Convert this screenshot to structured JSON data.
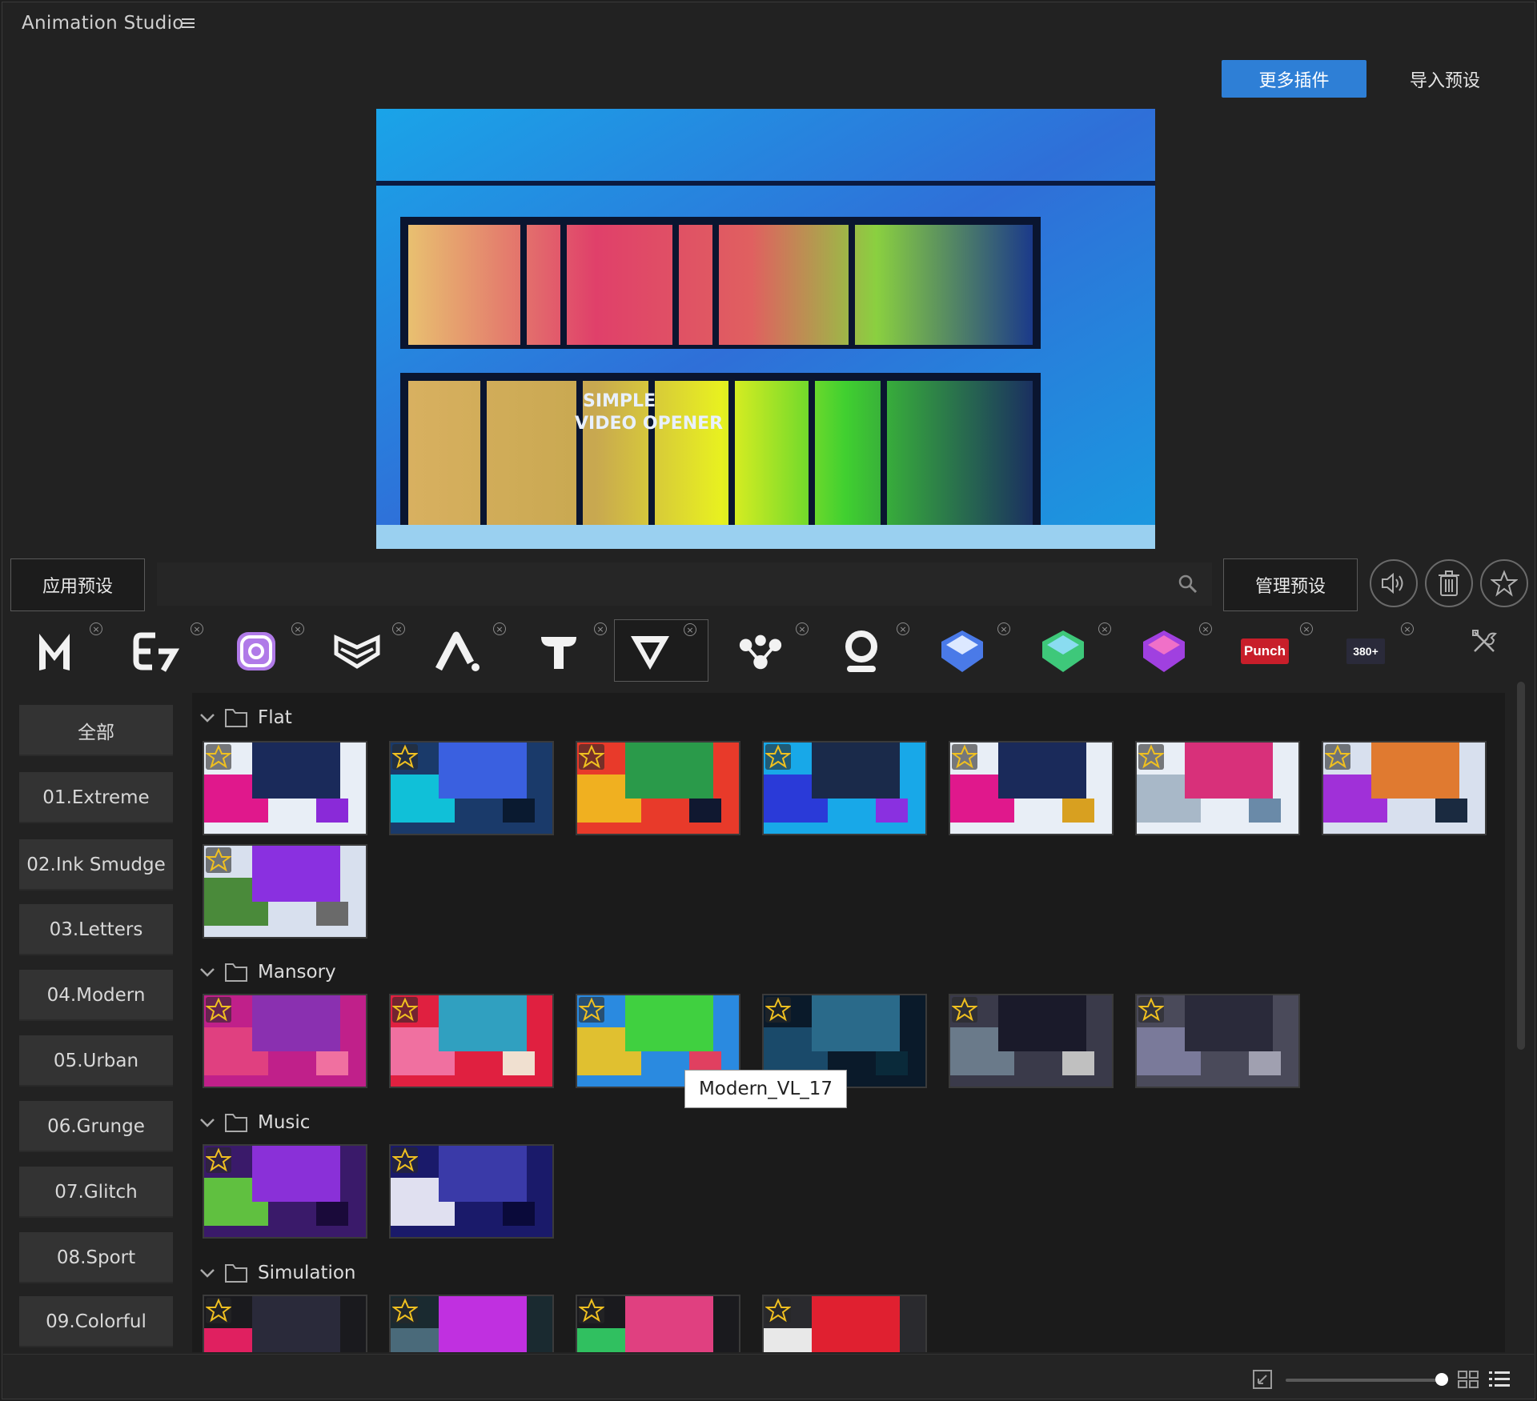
{
  "app": {
    "title": "Animation Studio"
  },
  "header": {
    "more_plugins_label": "更多插件",
    "import_presets_label": "导入预设"
  },
  "preview": {
    "overlay_line1": "SIMPLE",
    "overlay_line2": "VIDEO OPENER"
  },
  "toolbar": {
    "apply_label": "应用预设",
    "search_placeholder": "",
    "manage_label": "管理预设"
  },
  "plugins": [
    {
      "name": "M",
      "icon": "m-logo-icon"
    },
    {
      "name": "E",
      "icon": "e-logo-icon"
    },
    {
      "name": "camera",
      "icon": "camera-logo-icon"
    },
    {
      "name": "layers",
      "icon": "layers-logo-icon"
    },
    {
      "name": "A",
      "icon": "a-logo-icon"
    },
    {
      "name": "T",
      "icon": "t-logo-icon"
    },
    {
      "name": "V",
      "icon": "v-logo-icon",
      "active": true
    },
    {
      "name": "nodes",
      "icon": "nodes-logo-icon"
    },
    {
      "name": "O",
      "icon": "o-logo-icon"
    },
    {
      "name": "blue-cube",
      "icon": "blue-cube-logo-icon"
    },
    {
      "name": "green-cube",
      "icon": "green-cube-logo-icon"
    },
    {
      "name": "pink-cube",
      "icon": "pink-cube-logo-icon"
    },
    {
      "name": "Punch",
      "icon": "punch-logo-icon",
      "text": "Punch"
    },
    {
      "name": "380+",
      "icon": "transitions-logo-icon",
      "text": "380+"
    }
  ],
  "categories": [
    "全部",
    "01.Extreme",
    "02.Ink Smudge",
    "03.Letters",
    "04.Modern",
    "05.Urban",
    "06.Grunge",
    "07.Glitch",
    "08.Sport",
    "09.Colorful"
  ],
  "groups": [
    {
      "name": "Flat",
      "count": 8
    },
    {
      "name": "Mansory",
      "count": 6
    },
    {
      "name": "Music",
      "count": 2
    },
    {
      "name": "Simulation",
      "count": 4
    }
  ],
  "tooltip": "Modern_VL_17",
  "colors": {
    "accent": "#2e7fd6",
    "panel": "#1b1b1b",
    "category_bg": "#333333"
  }
}
